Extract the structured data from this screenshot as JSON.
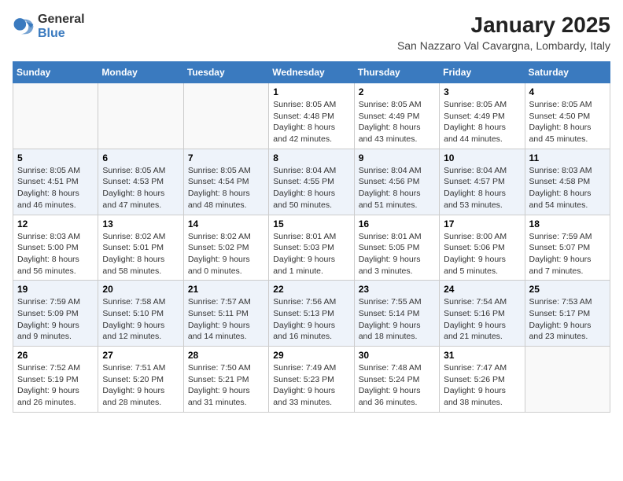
{
  "logo": {
    "general": "General",
    "blue": "Blue"
  },
  "title": "January 2025",
  "subtitle": "San Nazzaro Val Cavargna, Lombardy, Italy",
  "days_of_week": [
    "Sunday",
    "Monday",
    "Tuesday",
    "Wednesday",
    "Thursday",
    "Friday",
    "Saturday"
  ],
  "weeks": [
    [
      {
        "day": "",
        "info": ""
      },
      {
        "day": "",
        "info": ""
      },
      {
        "day": "",
        "info": ""
      },
      {
        "day": "1",
        "info": "Sunrise: 8:05 AM\nSunset: 4:48 PM\nDaylight: 8 hours and 42 minutes."
      },
      {
        "day": "2",
        "info": "Sunrise: 8:05 AM\nSunset: 4:49 PM\nDaylight: 8 hours and 43 minutes."
      },
      {
        "day": "3",
        "info": "Sunrise: 8:05 AM\nSunset: 4:49 PM\nDaylight: 8 hours and 44 minutes."
      },
      {
        "day": "4",
        "info": "Sunrise: 8:05 AM\nSunset: 4:50 PM\nDaylight: 8 hours and 45 minutes."
      }
    ],
    [
      {
        "day": "5",
        "info": "Sunrise: 8:05 AM\nSunset: 4:51 PM\nDaylight: 8 hours and 46 minutes."
      },
      {
        "day": "6",
        "info": "Sunrise: 8:05 AM\nSunset: 4:53 PM\nDaylight: 8 hours and 47 minutes."
      },
      {
        "day": "7",
        "info": "Sunrise: 8:05 AM\nSunset: 4:54 PM\nDaylight: 8 hours and 48 minutes."
      },
      {
        "day": "8",
        "info": "Sunrise: 8:04 AM\nSunset: 4:55 PM\nDaylight: 8 hours and 50 minutes."
      },
      {
        "day": "9",
        "info": "Sunrise: 8:04 AM\nSunset: 4:56 PM\nDaylight: 8 hours and 51 minutes."
      },
      {
        "day": "10",
        "info": "Sunrise: 8:04 AM\nSunset: 4:57 PM\nDaylight: 8 hours and 53 minutes."
      },
      {
        "day": "11",
        "info": "Sunrise: 8:03 AM\nSunset: 4:58 PM\nDaylight: 8 hours and 54 minutes."
      }
    ],
    [
      {
        "day": "12",
        "info": "Sunrise: 8:03 AM\nSunset: 5:00 PM\nDaylight: 8 hours and 56 minutes."
      },
      {
        "day": "13",
        "info": "Sunrise: 8:02 AM\nSunset: 5:01 PM\nDaylight: 8 hours and 58 minutes."
      },
      {
        "day": "14",
        "info": "Sunrise: 8:02 AM\nSunset: 5:02 PM\nDaylight: 9 hours and 0 minutes."
      },
      {
        "day": "15",
        "info": "Sunrise: 8:01 AM\nSunset: 5:03 PM\nDaylight: 9 hours and 1 minute."
      },
      {
        "day": "16",
        "info": "Sunrise: 8:01 AM\nSunset: 5:05 PM\nDaylight: 9 hours and 3 minutes."
      },
      {
        "day": "17",
        "info": "Sunrise: 8:00 AM\nSunset: 5:06 PM\nDaylight: 9 hours and 5 minutes."
      },
      {
        "day": "18",
        "info": "Sunrise: 7:59 AM\nSunset: 5:07 PM\nDaylight: 9 hours and 7 minutes."
      }
    ],
    [
      {
        "day": "19",
        "info": "Sunrise: 7:59 AM\nSunset: 5:09 PM\nDaylight: 9 hours and 9 minutes."
      },
      {
        "day": "20",
        "info": "Sunrise: 7:58 AM\nSunset: 5:10 PM\nDaylight: 9 hours and 12 minutes."
      },
      {
        "day": "21",
        "info": "Sunrise: 7:57 AM\nSunset: 5:11 PM\nDaylight: 9 hours and 14 minutes."
      },
      {
        "day": "22",
        "info": "Sunrise: 7:56 AM\nSunset: 5:13 PM\nDaylight: 9 hours and 16 minutes."
      },
      {
        "day": "23",
        "info": "Sunrise: 7:55 AM\nSunset: 5:14 PM\nDaylight: 9 hours and 18 minutes."
      },
      {
        "day": "24",
        "info": "Sunrise: 7:54 AM\nSunset: 5:16 PM\nDaylight: 9 hours and 21 minutes."
      },
      {
        "day": "25",
        "info": "Sunrise: 7:53 AM\nSunset: 5:17 PM\nDaylight: 9 hours and 23 minutes."
      }
    ],
    [
      {
        "day": "26",
        "info": "Sunrise: 7:52 AM\nSunset: 5:19 PM\nDaylight: 9 hours and 26 minutes."
      },
      {
        "day": "27",
        "info": "Sunrise: 7:51 AM\nSunset: 5:20 PM\nDaylight: 9 hours and 28 minutes."
      },
      {
        "day": "28",
        "info": "Sunrise: 7:50 AM\nSunset: 5:21 PM\nDaylight: 9 hours and 31 minutes."
      },
      {
        "day": "29",
        "info": "Sunrise: 7:49 AM\nSunset: 5:23 PM\nDaylight: 9 hours and 33 minutes."
      },
      {
        "day": "30",
        "info": "Sunrise: 7:48 AM\nSunset: 5:24 PM\nDaylight: 9 hours and 36 minutes."
      },
      {
        "day": "31",
        "info": "Sunrise: 7:47 AM\nSunset: 5:26 PM\nDaylight: 9 hours and 38 minutes."
      },
      {
        "day": "",
        "info": ""
      }
    ]
  ]
}
